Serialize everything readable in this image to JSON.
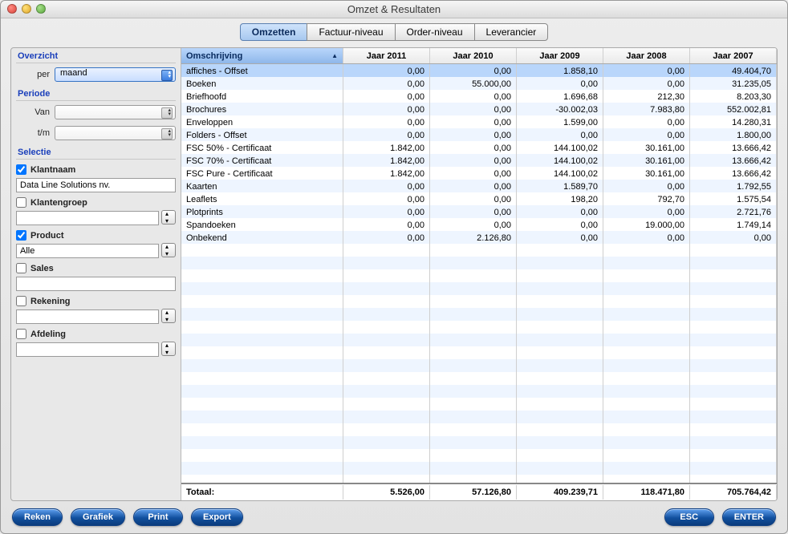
{
  "window": {
    "title": "Omzet & Resultaten"
  },
  "tabs": [
    {
      "label": "Omzetten",
      "active": true
    },
    {
      "label": "Factuur-niveau"
    },
    {
      "label": "Order-niveau"
    },
    {
      "label": "Leverancier"
    }
  ],
  "sidebar": {
    "overzicht": {
      "title": "Overzicht",
      "per_label": "per",
      "per_value": "maand"
    },
    "periode": {
      "title": "Periode",
      "van_label": "Van",
      "tm_label": "t/m",
      "van_value": "",
      "tm_value": ""
    },
    "selectie": {
      "title": "Selectie",
      "klantnaam": {
        "label": "Klantnaam",
        "checked": true,
        "value": "Data Line Solutions nv."
      },
      "klantengroep": {
        "label": "Klantengroep",
        "checked": false,
        "value": ""
      },
      "product": {
        "label": "Product",
        "checked": true,
        "value": "Alle"
      },
      "sales": {
        "label": "Sales",
        "checked": false,
        "value": ""
      },
      "rekening": {
        "label": "Rekening",
        "checked": false,
        "value": ""
      },
      "afdeling": {
        "label": "Afdeling",
        "checked": false,
        "value": ""
      }
    }
  },
  "table": {
    "columns": [
      "Omschrijving",
      "Jaar 2011",
      "Jaar 2010",
      "Jaar 2009",
      "Jaar 2008",
      "Jaar 2007"
    ],
    "rows": [
      {
        "desc": "affiches - Offset",
        "y2011": "0,00",
        "y2010": "0,00",
        "y2009": "1.858,10",
        "y2008": "0,00",
        "y2007": "49.404,70",
        "selected": true
      },
      {
        "desc": "Boeken",
        "y2011": "0,00",
        "y2010": "55.000,00",
        "y2009": "0,00",
        "y2008": "0,00",
        "y2007": "31.235,05"
      },
      {
        "desc": "Briefhoofd",
        "y2011": "0,00",
        "y2010": "0,00",
        "y2009": "1.696,68",
        "y2008": "212,30",
        "y2007": "8.203,30"
      },
      {
        "desc": "Brochures",
        "y2011": "0,00",
        "y2010": "0,00",
        "y2009": "-30.002,03",
        "y2008": "7.983,80",
        "y2007": "552.002,81"
      },
      {
        "desc": "Enveloppen",
        "y2011": "0,00",
        "y2010": "0,00",
        "y2009": "1.599,00",
        "y2008": "0,00",
        "y2007": "14.280,31"
      },
      {
        "desc": "Folders - Offset",
        "y2011": "0,00",
        "y2010": "0,00",
        "y2009": "0,00",
        "y2008": "0,00",
        "y2007": "1.800,00"
      },
      {
        "desc": "FSC 50% - Certificaat",
        "y2011": "1.842,00",
        "y2010": "0,00",
        "y2009": "144.100,02",
        "y2008": "30.161,00",
        "y2007": "13.666,42"
      },
      {
        "desc": "FSC 70% - Certificaat",
        "y2011": "1.842,00",
        "y2010": "0,00",
        "y2009": "144.100,02",
        "y2008": "30.161,00",
        "y2007": "13.666,42"
      },
      {
        "desc": "FSC Pure - Certificaat",
        "y2011": "1.842,00",
        "y2010": "0,00",
        "y2009": "144.100,02",
        "y2008": "30.161,00",
        "y2007": "13.666,42"
      },
      {
        "desc": "Kaarten",
        "y2011": "0,00",
        "y2010": "0,00",
        "y2009": "1.589,70",
        "y2008": "0,00",
        "y2007": "1.792,55"
      },
      {
        "desc": "Leaflets",
        "y2011": "0,00",
        "y2010": "0,00",
        "y2009": "198,20",
        "y2008": "792,70",
        "y2007": "1.575,54"
      },
      {
        "desc": "Plotprints",
        "y2011": "0,00",
        "y2010": "0,00",
        "y2009": "0,00",
        "y2008": "0,00",
        "y2007": "2.721,76"
      },
      {
        "desc": "Spandoeken",
        "y2011": "0,00",
        "y2010": "0,00",
        "y2009": "0,00",
        "y2008": "19.000,00",
        "y2007": "1.749,14"
      },
      {
        "desc": "Onbekend",
        "y2011": "0,00",
        "y2010": "2.126,80",
        "y2009": "0,00",
        "y2008": "0,00",
        "y2007": "0,00"
      }
    ],
    "total": {
      "label": "Totaal:",
      "y2011": "5.526,00",
      "y2010": "57.126,80",
      "y2009": "409.239,71",
      "y2008": "118.471,80",
      "y2007": "705.764,42"
    }
  },
  "buttons": {
    "reken": "Reken",
    "grafiek": "Grafiek",
    "print": "Print",
    "export": "Export",
    "esc": "ESC",
    "enter": "ENTER"
  }
}
